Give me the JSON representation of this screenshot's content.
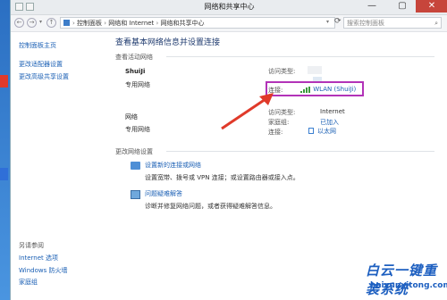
{
  "window": {
    "title": "网络和共享中心"
  },
  "controls": {
    "minimize": "—",
    "maximize": "▢",
    "close": "✕"
  },
  "nav": {
    "back": "←",
    "forward": "→",
    "up": "↑"
  },
  "breadcrumb": [
    "控制面板",
    "网络和 Internet",
    "网络和共享中心"
  ],
  "search": {
    "placeholder": "搜索控制面板"
  },
  "sidebar": {
    "items": [
      {
        "label": "控制面板主页"
      },
      {
        "label": "更改适配器设置"
      },
      {
        "label": "更改高级共享设置"
      }
    ],
    "see_also": {
      "heading": "另请参阅",
      "items": [
        {
          "label": "Internet 选项"
        },
        {
          "label": "Windows 防火墙"
        },
        {
          "label": "家庭组"
        }
      ]
    }
  },
  "main": {
    "heading": "查看基本网络信息并设置连接",
    "active_networks_label": "查看活动网络",
    "networks": [
      {
        "name": "ShuiJi",
        "type": "专用网络",
        "access_type_label": "访问类型:",
        "access_type_value": "",
        "connections_label": "连接:",
        "connections_value": "WLAN (ShuiJi)"
      },
      {
        "name": "网络",
        "type": "专用网络",
        "access_type_label": "访问类型:",
        "access_type_value": "Internet",
        "homegroup_label": "家庭组:",
        "homegroup_value": "已加入",
        "connections_label": "连接:",
        "connections_value": "以太网"
      }
    ],
    "change_settings_label": "更改网络设置",
    "tasks": [
      {
        "title": "设置新的连接或网络",
        "desc": "设置宽带、拨号或 VPN 连接；或设置路由器或接入点。"
      },
      {
        "title": "问题疑难解答",
        "desc": "诊断并修复网络问题，或者获得疑难解答信息。"
      }
    ]
  },
  "watermark": {
    "main": "白云一键重装系统",
    "url": "baiyunxitong.com"
  },
  "colors": {
    "link": "#1a5fb4",
    "highlight": "#b233b8",
    "arrow": "#e03a2a"
  }
}
